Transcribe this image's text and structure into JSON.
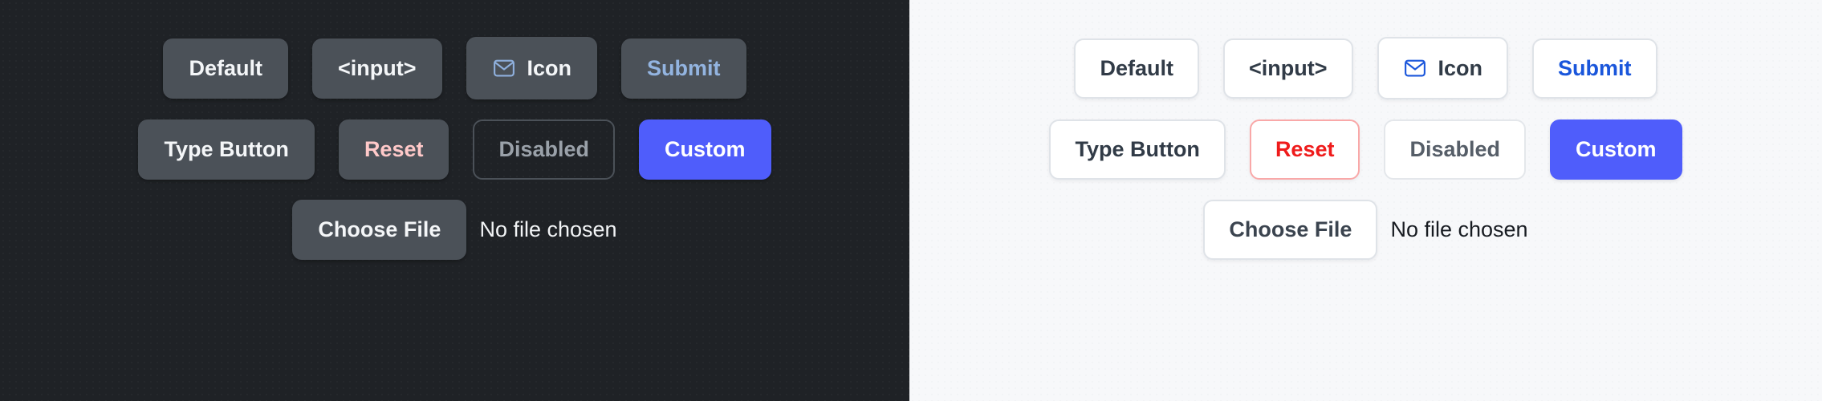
{
  "panels": [
    {
      "theme": "dark",
      "background": "#1f2226",
      "rows": [
        {
          "buttons": [
            {
              "label": "Default",
              "variant": "solid",
              "icon": null
            },
            {
              "label": "<input>",
              "variant": "solid",
              "icon": null
            },
            {
              "label": "Icon",
              "variant": "solid",
              "icon": "mail-icon"
            },
            {
              "label": "Submit",
              "variant": "accent",
              "icon": null
            }
          ]
        },
        {
          "buttons": [
            {
              "label": "Type Button",
              "variant": "solid",
              "icon": null
            },
            {
              "label": "Reset",
              "variant": "danger",
              "icon": null
            },
            {
              "label": "Disabled",
              "variant": "disabled",
              "icon": null
            },
            {
              "label": "Custom",
              "variant": "custom",
              "icon": null
            }
          ]
        }
      ],
      "file_input": {
        "button_label": "Choose File",
        "status_text": "No file chosen"
      },
      "colors": {
        "button_fill": "#4b5158",
        "text": "#f4f6f8",
        "accent": "#93b4e0",
        "danger": "#ffc9c9",
        "disabled_text": "#9aa1a9",
        "disabled_border": "#4b5158",
        "custom_fill": "#4f5dfb",
        "icon_stroke": "#8fb0dd"
      }
    },
    {
      "theme": "light",
      "background": "#f7f8fa",
      "rows": [
        {
          "buttons": [
            {
              "label": "Default",
              "variant": "solid",
              "icon": null
            },
            {
              "label": "<input>",
              "variant": "solid",
              "icon": null
            },
            {
              "label": "Icon",
              "variant": "solid",
              "icon": "mail-icon"
            },
            {
              "label": "Submit",
              "variant": "accent",
              "icon": null
            }
          ]
        },
        {
          "buttons": [
            {
              "label": "Type Button",
              "variant": "solid",
              "icon": null
            },
            {
              "label": "Reset",
              "variant": "danger",
              "icon": null
            },
            {
              "label": "Disabled",
              "variant": "disabled",
              "icon": null
            },
            {
              "label": "Custom",
              "variant": "custom",
              "icon": null
            }
          ]
        }
      ],
      "file_input": {
        "button_label": "Choose File",
        "status_text": "No file chosen"
      },
      "colors": {
        "button_fill": "#ffffff",
        "button_border": "#dfe3e8",
        "text": "#313b47",
        "accent": "#1a56db",
        "danger": "#ef1b1b",
        "danger_border": "#f9a8a8",
        "disabled_text": "#565e68",
        "disabled_border": "#e4e7eb",
        "custom_fill": "#4f5dfb",
        "icon_stroke": "#1a56db"
      }
    }
  ]
}
